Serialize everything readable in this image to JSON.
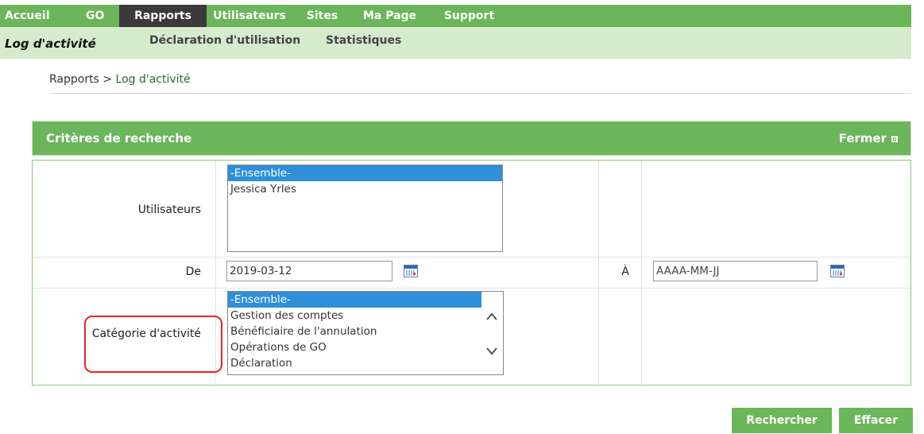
{
  "top_nav": [
    {
      "label": "Accueil"
    },
    {
      "label": "GO"
    },
    {
      "label": "Rapports"
    },
    {
      "label": "Utilisateurs"
    },
    {
      "label": "Sites"
    },
    {
      "label": "Ma Page"
    },
    {
      "label": "Support"
    }
  ],
  "sub_nav": [
    {
      "label": "Log d'activité"
    },
    {
      "label": "Déclaration d'utilisation"
    },
    {
      "label": "Statistiques"
    }
  ],
  "breadcrumb": {
    "root": "Rapports",
    "sep": " > ",
    "current": "Log d'activité"
  },
  "panel": {
    "title": "Critères de recherche",
    "close_label": "Fermer"
  },
  "form": {
    "users_label": "Utilisateurs",
    "users_options": [
      "-Ensemble-",
      "Jessica Yrles"
    ],
    "from_label": "De",
    "from_value": "2019-03-12",
    "to_label": "À",
    "to_placeholder": "AAAA-MM-JJ",
    "category_label": "Catégorie d'activité",
    "category_options": [
      "-Ensemble-",
      "Gestion des comptes",
      "Bénéficiaire de l'annulation",
      "Opérations de GO",
      "Déclaration"
    ],
    "scroll_up": "^",
    "scroll_down": "⌄"
  },
  "buttons": {
    "search": "Rechercher",
    "clear": "Effacer"
  },
  "colors": {
    "nav_green": "#6bb55a",
    "subnav_bg": "#d6ebcc",
    "selected_blue": "#2f8fd8",
    "highlight_red": "#e22222"
  }
}
